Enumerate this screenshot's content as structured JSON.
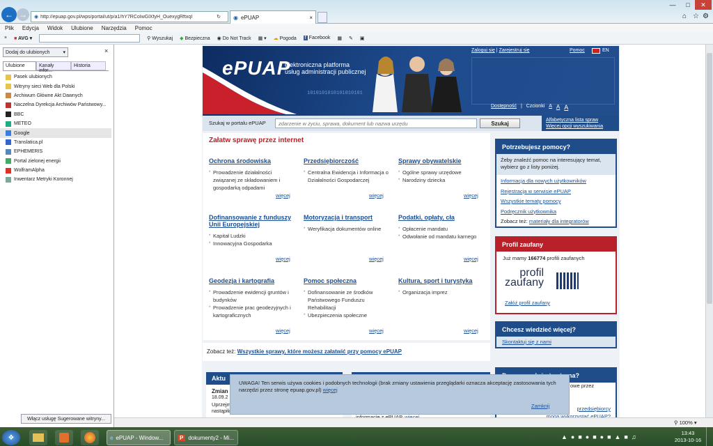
{
  "browser": {
    "url": "http://epuap.gov.pl/wps/portal/ut/p/a1/hY7RCoIwGlXfyH_OuexygRftxqI",
    "tab_title": "ePUAP",
    "menu": [
      "Plik",
      "Edycja",
      "Widok",
      "Ulubione",
      "Narzędzia",
      "Pomoc"
    ],
    "toolbar": {
      "avg": "AVG",
      "search_btn": "Wyszukaj",
      "secure": "Bezpieczna",
      "dnt": "Do Not Track",
      "weather": "Pogoda",
      "facebook": "Facebook"
    }
  },
  "sidebar": {
    "add_btn": "Dodaj do ulubionych",
    "tabs": [
      "Ulubione",
      "Kanały infor...",
      "Historia"
    ],
    "items": [
      "Pasek ulubionych",
      "Witryny sieci Web dla Polski",
      "Archiwum Główne Akt Dawnych",
      "Naczelna Dyrekcja Archiwów Państwowy...",
      "BBC",
      "METEO",
      "Google",
      "Translatica.pl",
      "EPHEMERIS",
      "Portal zielonej energii",
      "WolframAlpha",
      "Inwentarz Metryki Koronnej"
    ],
    "suggest_btn": "Włącz usługę Sugerowane witryny..."
  },
  "header": {
    "logo": "ePUAP",
    "tagline1": "elektroniczna platforma",
    "tagline2": "usług administracji publicznej",
    "login": "Zaloguj się",
    "register": "Zarejestruj się",
    "help": "Pomoc",
    "lang": "EN",
    "access": "Dostępność",
    "font_label": "Czcionki",
    "font_a1": "A",
    "font_a2": "A",
    "font_a3": "A",
    "binary": "1010101010101010101"
  },
  "search": {
    "label": "Szukaj w portalu ePUAP",
    "placeholder": "zdarzenie w życiu, sprawa, dokument lub nazwa urzędu",
    "button": "Szukaj",
    "link1": "Alfabetyczna lista spraw",
    "link2": "Więcej opcji wyszukiwania"
  },
  "main": {
    "heading": "Załatw sprawę przez internet",
    "more": "więcej",
    "categories": [
      {
        "title": "Ochrona środowiska",
        "items": [
          "Prowadzenie działalności związanej ze składowaniem i gospodarką odpadami"
        ]
      },
      {
        "title": "Przedsiębiorczość",
        "items": [
          "Centralna Ewidencja i Informacja o Działalności Gospodarczej"
        ]
      },
      {
        "title": "Sprawy obywatelskie",
        "items": [
          "Ogólne sprawy urzędowe",
          "Narodziny dziecka"
        ]
      },
      {
        "title": "Dofinansowanie z funduszy Unii Europejskiej",
        "items": [
          "Kapitał Ludzki",
          "Innowacyjna Gospodarka"
        ]
      },
      {
        "title": "Motoryzacja i transport",
        "items": [
          "Weryfikacja dokumentów online"
        ]
      },
      {
        "title": "Podatki, opłaty, cła",
        "items": [
          "Opłacenie mandatu",
          "Odwołanie od mandatu karnego"
        ]
      },
      {
        "title": "Geodezja i kartografia",
        "items": [
          "Prowadzenie ewidencji gruntów i budynków",
          "Prowadzenie prac geodezyjnych i kartograficznych"
        ]
      },
      {
        "title": "Pomoc społeczna",
        "items": [
          "Dofinansowanie ze środków Państwowego Funduszu Rehabilitacji",
          "Ubezpieczenia społeczne"
        ]
      },
      {
        "title": "Kultura, sport i turystyka",
        "items": [
          "Organizacja imprez"
        ]
      }
    ],
    "see_also": "Zobacz też:",
    "see_all": "Wszystkie sprawy, które możesz załatwić przy pomocy ePUAP",
    "news": "Aktu",
    "news_item": "Zmian",
    "news_date": "18.09.2",
    "news_text1": "Uprzejm",
    "news_text2": "nastąpiła zmiana adresacji serwerów ePUAP",
    "news_right": "informacje z ePUAP.",
    "news_more": "więcej"
  },
  "right": {
    "help_title": "Potrzebujesz pomocy?",
    "help_text": "Żeby znaleźć pomoc na interesujący temat, wybierz go z listy poniżej.",
    "help_links": [
      "Informacja dla nowych użytkowników",
      "Rejestracja w serwisie ePUAP",
      "Wszystkie tematy pomocy",
      "Podręcznik użytkownika"
    ],
    "see_label": "Zobacz też:",
    "see_link": "materiały dla integratorów",
    "pz_title": "Profil zaufany",
    "pz_text_pre": "Już mamy",
    "pz_count": "166774",
    "pz_text_post": "profili zaufanych",
    "pz_logo1": "profil",
    "pz_logo2": "zaufany",
    "pz_link": "Załóż profil zaufany",
    "more_title": "Chcesz wiedzieć więcej?",
    "more_link": "Skontaktuj się z nami",
    "what_title": "Do czego służy ta strona?",
    "what_partial": "owe przez",
    "what_link1": "przedsiębiorcy",
    "what_link2": "mogą wykorzystać ePUAP?"
  },
  "cookie": {
    "text": "UWAGA! Ten serwis używa cookies i podobnych technologii (brak zmiany ustawienia przeglądarki oznacza akceptację zastosowania tych narzędzi przez stronę epuap.gov.pl)",
    "more": "więcej",
    "close": "Zamknij"
  },
  "status": {
    "zoom": "100%"
  },
  "taskbar": {
    "app1": "ePUAP - Window...",
    "app2": "dokumenty2 - Mi...",
    "time": "13:43",
    "date": "2013-10-16"
  }
}
